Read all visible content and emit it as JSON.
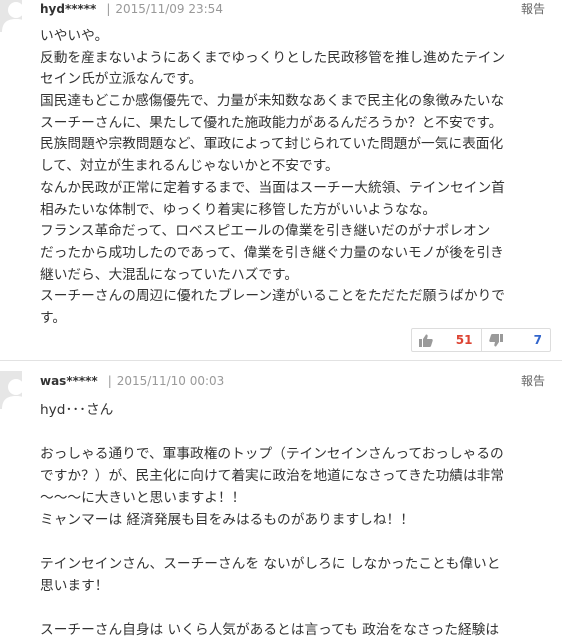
{
  "comments": [
    {
      "user": "hyd*****",
      "separator": "|",
      "date": "2015/11/09 23:54",
      "report_label": "報告",
      "lines": [
        "いやいや。",
        "反動を産まないようにあくまでゆっくりとした民政移管を推し進めたテイン",
        "セイン氏が立派なんです。",
        "国民達もどこか感傷優先で、力量が未知数なあくまで民主化の象徴みたいな",
        "スーチーさんに、果たして優れた施政能力があるんだろうか？と不安です。",
        "民族問題や宗教問題など、軍政によって封じられていた問題が一気に表面化",
        "して、対立が生まれるんじゃないかと不安です。",
        "なんか民政が正常に定着するまで、当面はスーチー大統領、テインセイン首",
        "相みたいな体制で、ゆっくり着実に移管した方がいいようなな。",
        "フランス革命だって、ロベスピエールの偉業を引き継いだのがナポレオン",
        "だったから成功したのであって、偉業を引き継ぐ力量のないモノが後を引き",
        "継いだら、大混乱になっていたハズです。",
        "スーチーさんの周辺に優れたブレーン達がいることをただただ願うばかりで",
        "す。"
      ],
      "votes": {
        "up_icon": "thumbs-up-icon",
        "up_count": "51",
        "down_icon": "thumbs-down-icon",
        "down_count": "7"
      }
    },
    {
      "user": "was*****",
      "separator": "|",
      "date": "2015/11/10 00:03",
      "report_label": "報告",
      "lines": [
        "hyd･･･さん",
        "",
        "おっしゃる通りで、軍事政権のトップ（テインセインさんっておっしゃるの",
        "ですか？）が、民主化に向けて着実に政治を地道になさってきた功績は非常",
        "～～～に大きいと思いますよ！！",
        "ミャンマーは 経済発展も目をみはるものがありますしね！！",
        "",
        "テインセインさん、スーチーさんを ないがしろに しなかったことも偉いと",
        "思います！",
        "",
        "スーチーさん自身は いくら人気があるとは言っても 政治をなさった経験は"
      ]
    }
  ],
  "colors": {
    "up_count": "#dd4433",
    "down_count": "#3366cc",
    "meta_gray": "#999999",
    "border": "#dddddd"
  }
}
